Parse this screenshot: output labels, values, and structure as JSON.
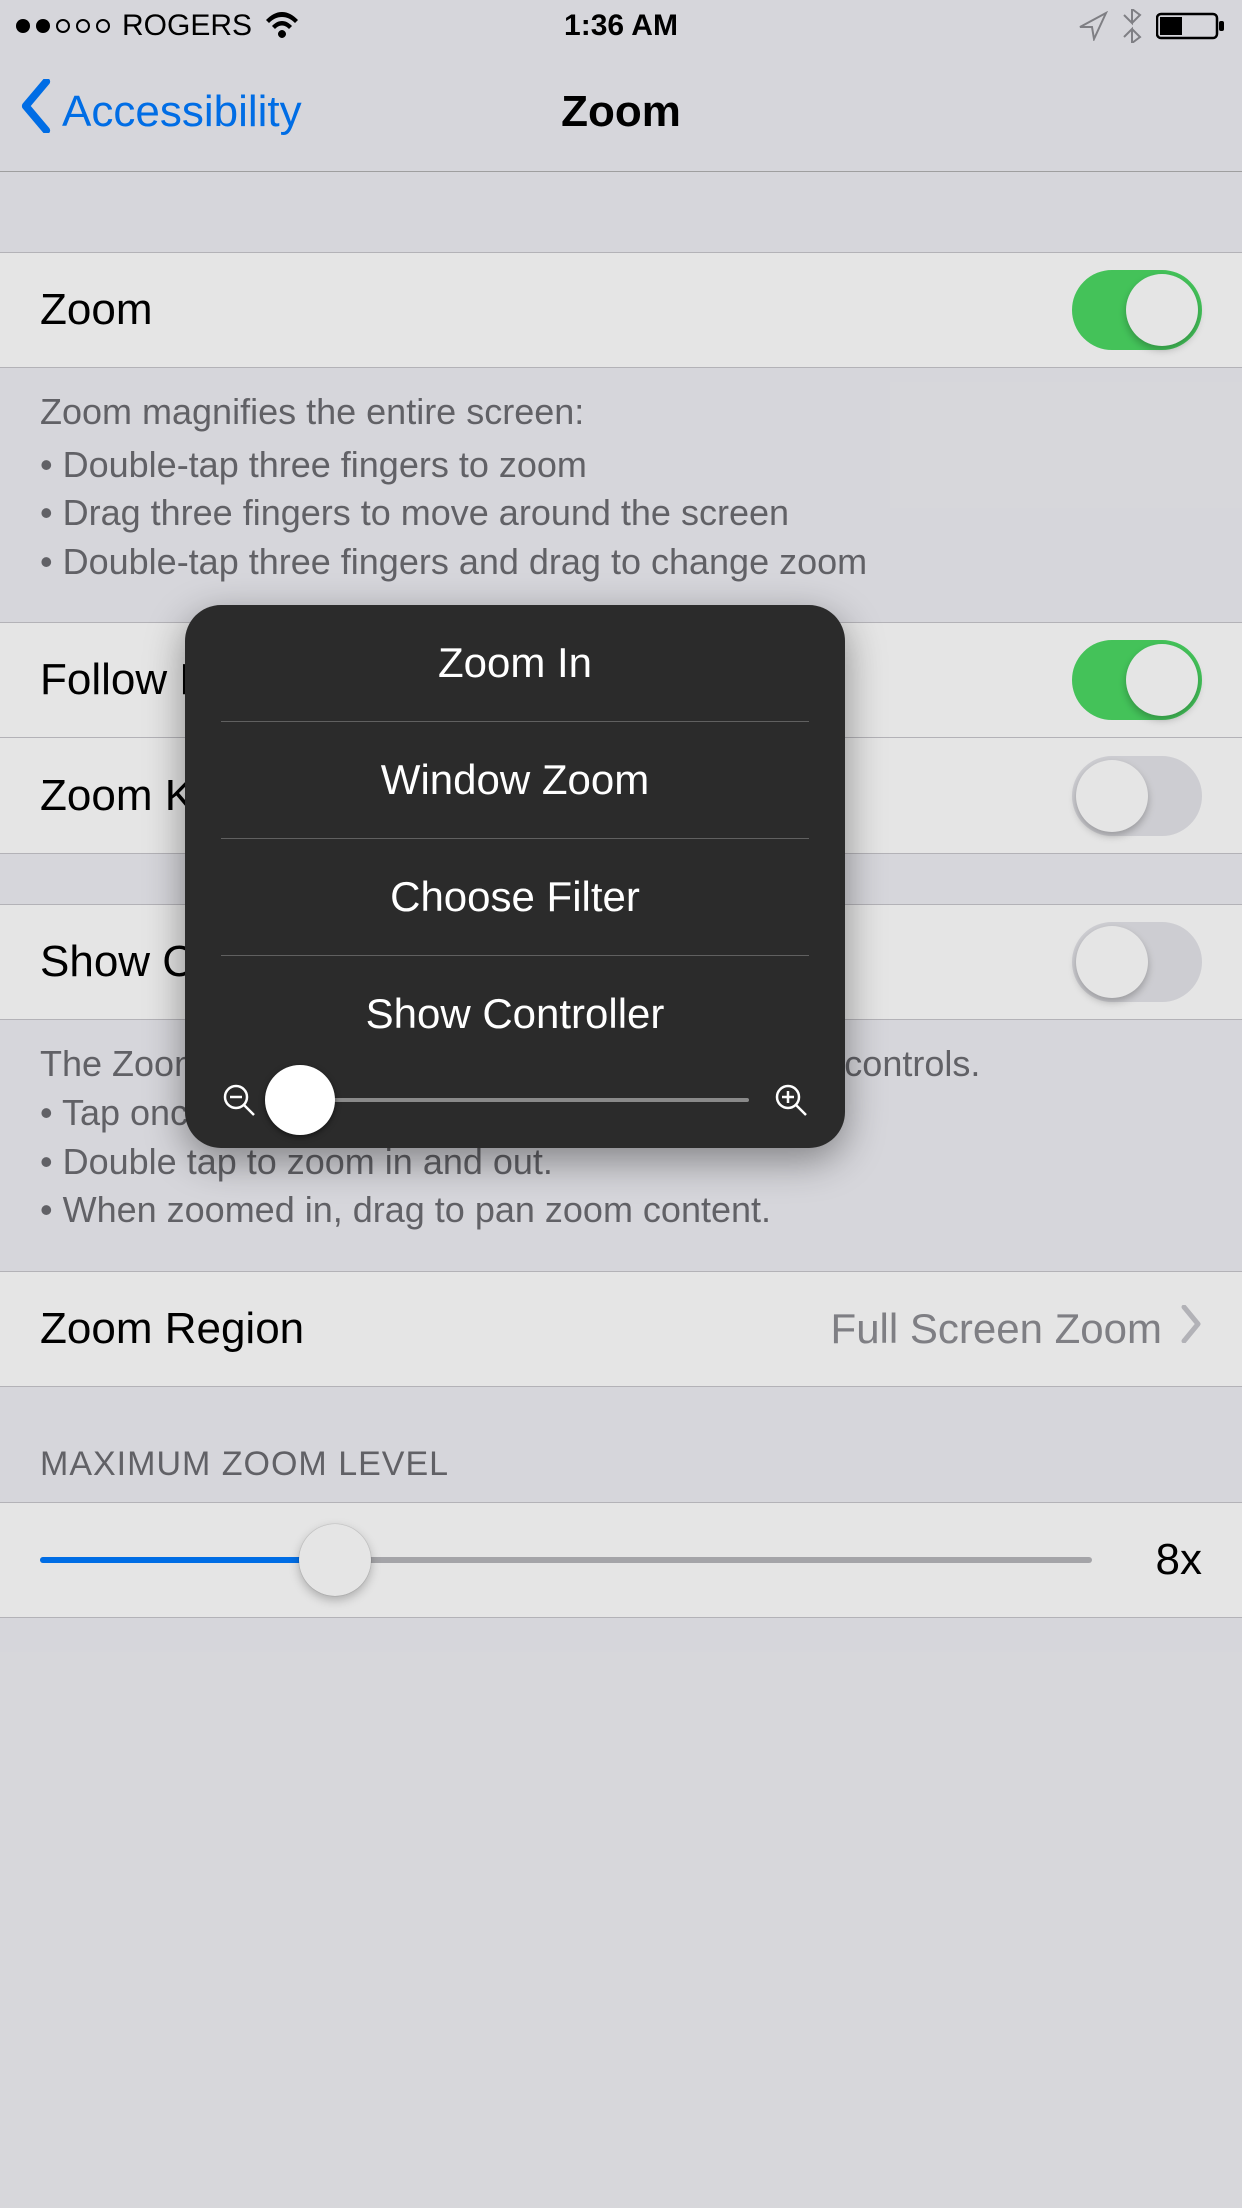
{
  "statusbar": {
    "carrier": "ROGERS",
    "time": "1:36 AM"
  },
  "nav": {
    "back": "Accessibility",
    "title": "Zoom"
  },
  "rows": {
    "zoom": {
      "label": "Zoom",
      "on": true
    },
    "followFocus": {
      "label": "Follow Focus",
      "on": true
    },
    "zoomKeyboard": {
      "label": "Zoom Keyboard",
      "on": false
    },
    "showController": {
      "label": "Show Controller",
      "on": false
    },
    "zoomRegion": {
      "label": "Zoom Region",
      "value": "Full Screen Zoom"
    }
  },
  "footers": {
    "zoom": {
      "title": "Zoom magnifies the entire screen:",
      "l1": "•  Double-tap three fingers to zoom",
      "l2": "•  Drag three fingers to move around the screen",
      "l3": "•  Double-tap three fingers and drag to change zoom"
    },
    "controller": {
      "l0": "The Zoom Controller allows quick access to zoom controls.",
      "l1": "• Tap once to show the Zoom menu.",
      "l2": "• Double tap to zoom in and out.",
      "l3": "• When zoomed in, drag to pan zoom content."
    }
  },
  "maxZoom": {
    "header": "MAXIMUM ZOOM LEVEL",
    "value": "8x",
    "fillPercent": 28
  },
  "popover": {
    "items": [
      "Zoom In",
      "Window Zoom",
      "Choose Filter",
      "Show Controller"
    ]
  }
}
